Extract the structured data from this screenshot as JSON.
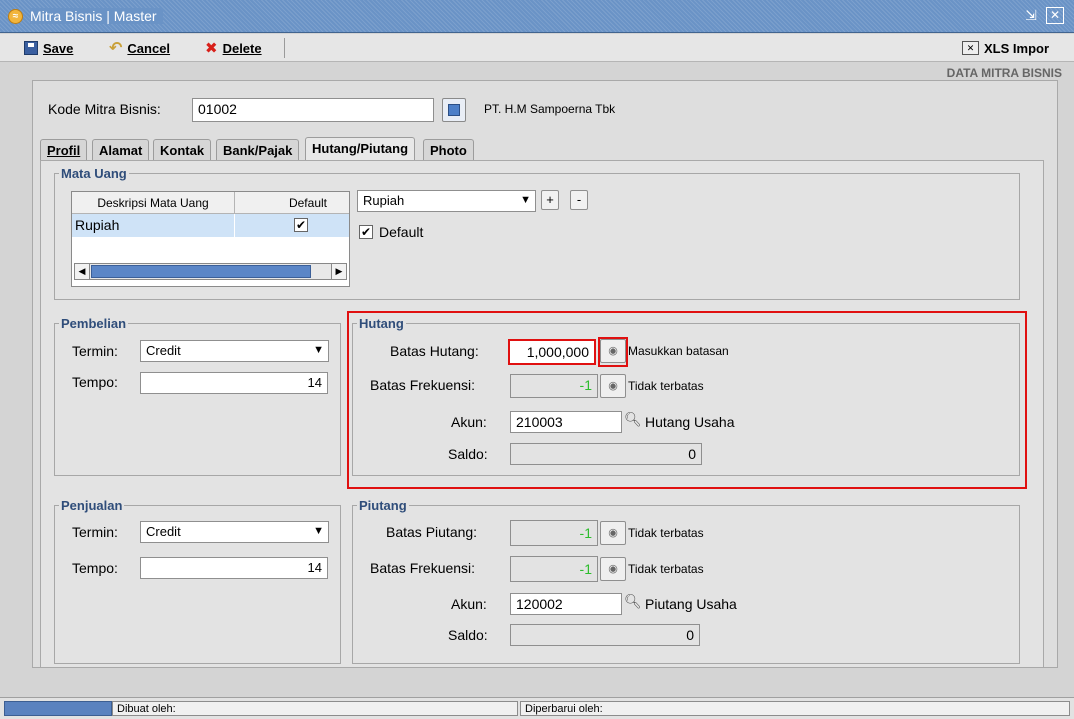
{
  "window": {
    "title": "Mitra Bisnis | Master"
  },
  "toolbar": {
    "save_label": "Save",
    "cancel_label": "Cancel",
    "delete_label": "Delete",
    "xls_import_label": "XLS Impor"
  },
  "header": {
    "section_title": "DATA MITRA BISNIS"
  },
  "kode": {
    "label": "Kode Mitra Bisnis:",
    "value": "01002",
    "company_name": "PT. H.M Sampoerna Tbk"
  },
  "tabs": [
    {
      "label": "Profil",
      "active": false
    },
    {
      "label": "Alamat",
      "active": false
    },
    {
      "label": "Kontak",
      "active": false
    },
    {
      "label": "Bank/Pajak",
      "active": false
    },
    {
      "label": "Hutang/Piutang",
      "active": true
    },
    {
      "label": "Photo",
      "active": false
    }
  ],
  "mata_uang": {
    "legend": "Mata Uang",
    "columns": [
      "Deskripsi Mata Uang",
      "Default"
    ],
    "rows": [
      {
        "deskripsi": "Rupiah",
        "default": true
      }
    ],
    "select_value": "Rupiah",
    "add_label": "+",
    "remove_label": "-",
    "default_checkbox_label": "Default"
  },
  "pembelian": {
    "legend": "Pembelian",
    "termin_label": "Termin:",
    "termin_value": "Credit",
    "tempo_label": "Tempo:",
    "tempo_value": "14"
  },
  "hutang": {
    "legend": "Hutang",
    "batas_label": "Batas Hutang:",
    "batas_value": "1,000,000",
    "batas_note": "Masukkan batasan",
    "frek_label": "Batas Frekuensi:",
    "frek_value": "-1",
    "frek_note": "Tidak terbatas",
    "akun_label": "Akun:",
    "akun_value": "210003",
    "akun_name": "Hutang Usaha",
    "saldo_label": "Saldo:",
    "saldo_value": "0"
  },
  "penjualan": {
    "legend": "Penjualan",
    "termin_label": "Termin:",
    "termin_value": "Credit",
    "tempo_label": "Tempo:",
    "tempo_value": "14"
  },
  "piutang": {
    "legend": "Piutang",
    "batas_label": "Batas Piutang:",
    "batas_value": "-1",
    "batas_note": "Tidak terbatas",
    "frek_label": "Batas Frekuensi:",
    "frek_value": "-1",
    "frek_note": "Tidak terbatas",
    "akun_label": "Akun:",
    "akun_value": "120002",
    "akun_name": "Piutang Usaha",
    "saldo_label": "Saldo:",
    "saldo_value": "0"
  },
  "status": {
    "dibuat_label": "Dibuat oleh:",
    "diperbarui_label": "Diperbarui oleh:"
  }
}
